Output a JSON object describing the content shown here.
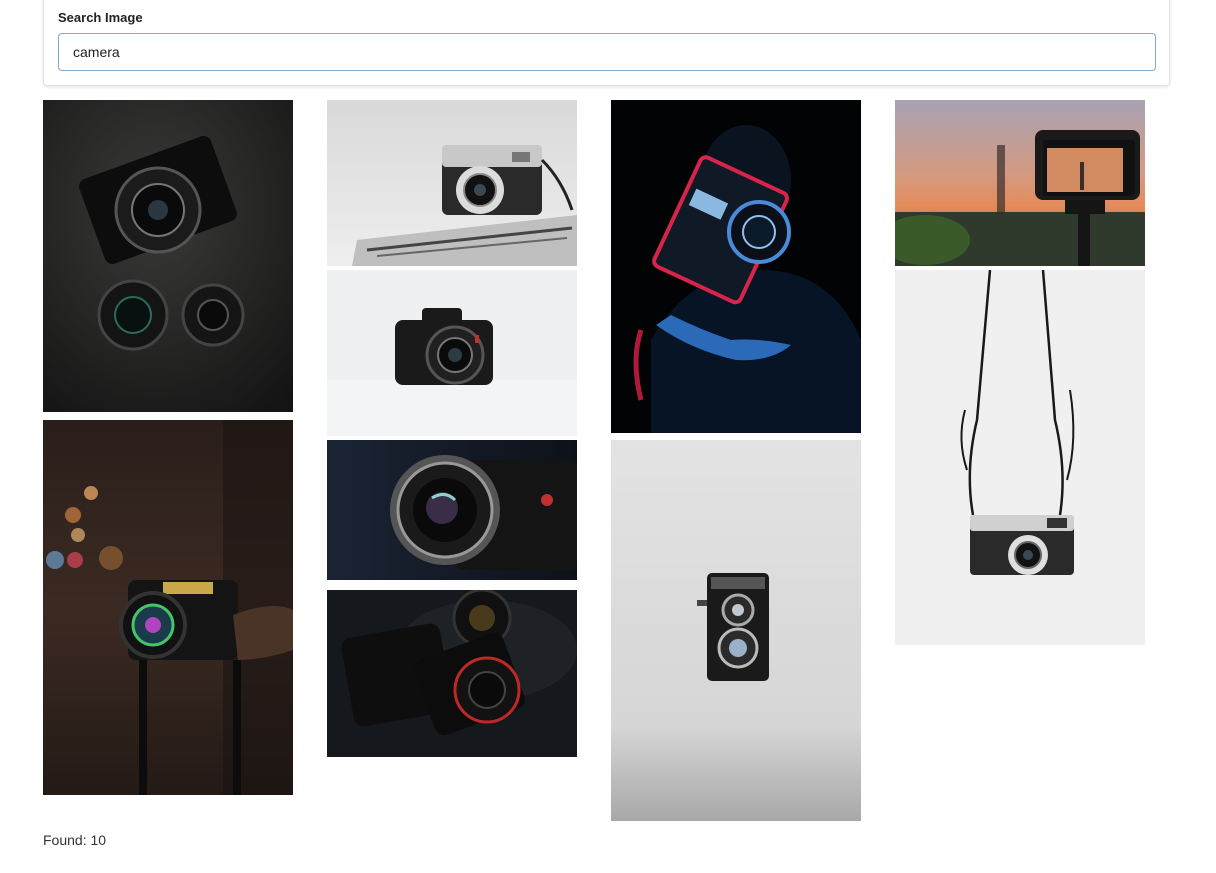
{
  "search": {
    "label": "Search Image",
    "value": "camera"
  },
  "results": {
    "found_label": "Found: 10"
  },
  "gallery": {
    "images": [
      {
        "name": "sony-camera-with-lenses",
        "theme": "dark"
      },
      {
        "name": "fujifilm-camera-bokeh-night",
        "theme": "night"
      },
      {
        "name": "silver-rangefinder-camera",
        "theme": "light"
      },
      {
        "name": "canon-dslr-on-white",
        "theme": "white"
      },
      {
        "name": "cinema-lens-closeup",
        "theme": "dark-blue"
      },
      {
        "name": "dslr-with-lenses-dark",
        "theme": "dark"
      },
      {
        "name": "person-holding-camera-neon",
        "theme": "neon"
      },
      {
        "name": "rolleiflex-twin-lens-camera",
        "theme": "grey"
      },
      {
        "name": "camera-on-tripod-sunset",
        "theme": "sunset"
      },
      {
        "name": "hanging-canon-film-camera",
        "theme": "white"
      }
    ]
  }
}
